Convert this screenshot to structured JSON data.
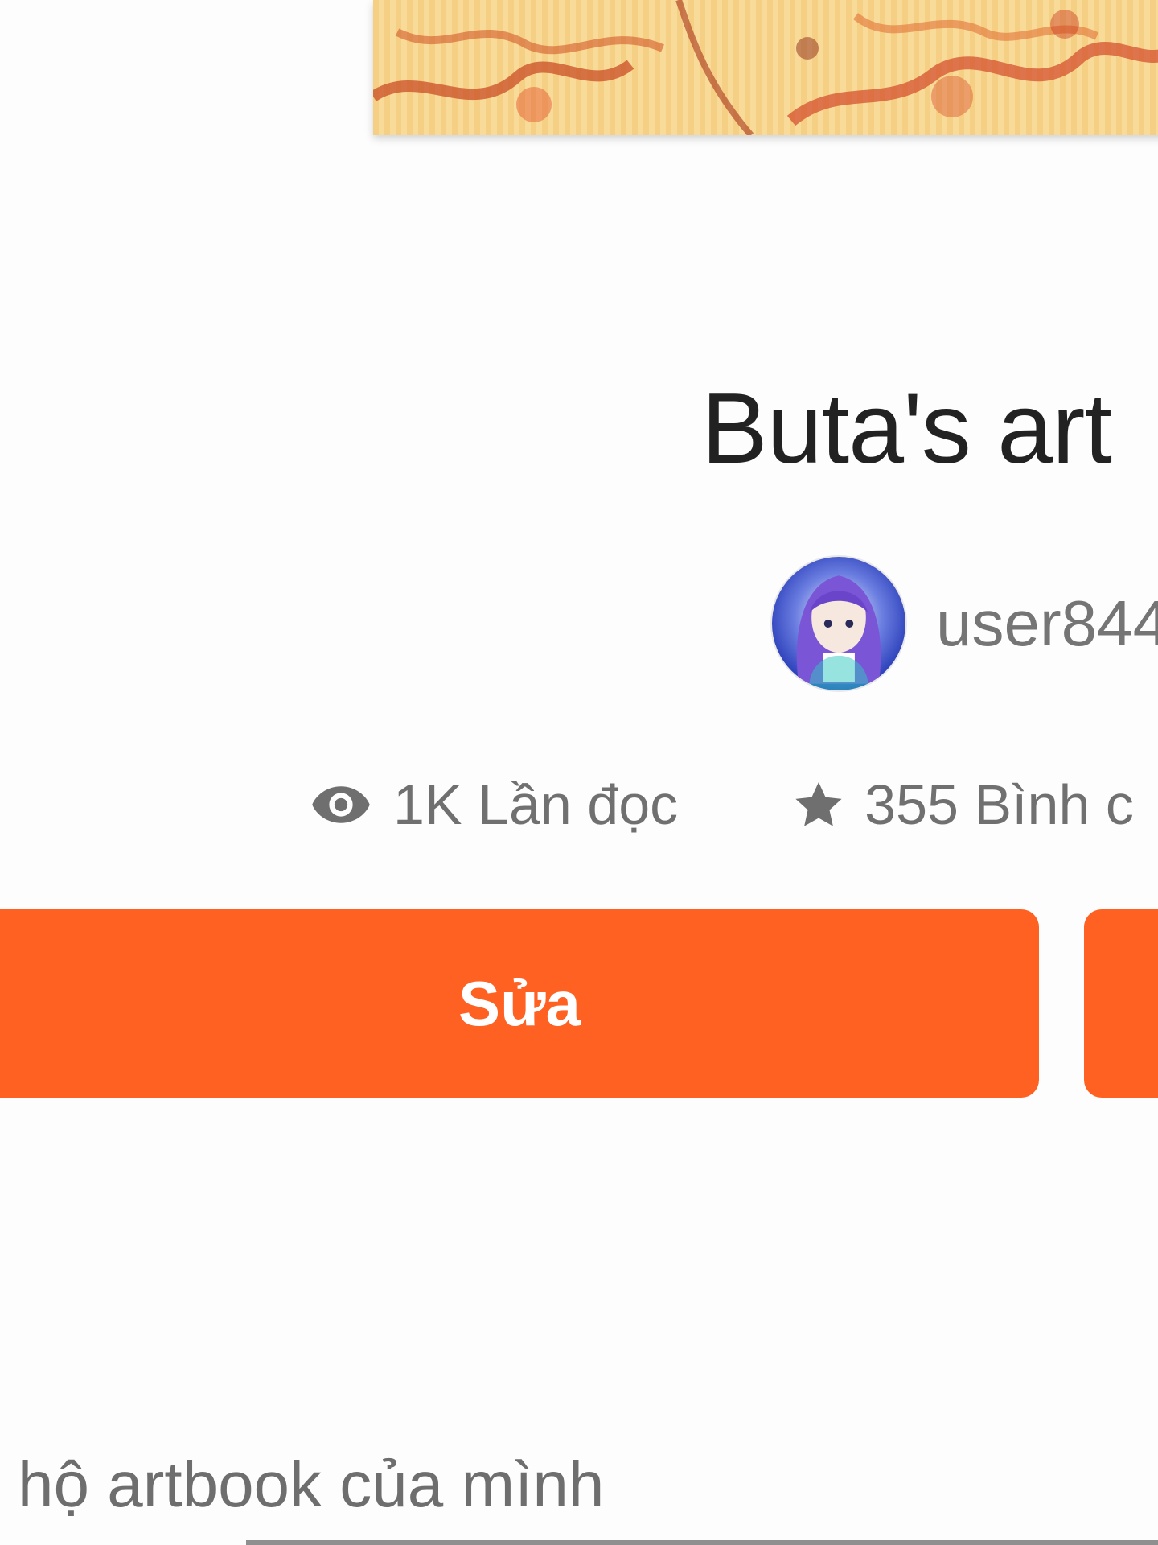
{
  "story": {
    "title": "Buta's art",
    "author": "user844"
  },
  "stats": {
    "reads": "1K Lần đọc",
    "votes": "355 Bình c",
    "reads_icon": "eye-icon",
    "votes_icon": "star-icon"
  },
  "actions": {
    "edit_label": "Sửa",
    "second_label": ""
  },
  "description": {
    "text": "hộ artbook của mình"
  },
  "colors": {
    "accent": "#ff6122",
    "text_dark": "#222222",
    "text_muted": "#757575"
  }
}
